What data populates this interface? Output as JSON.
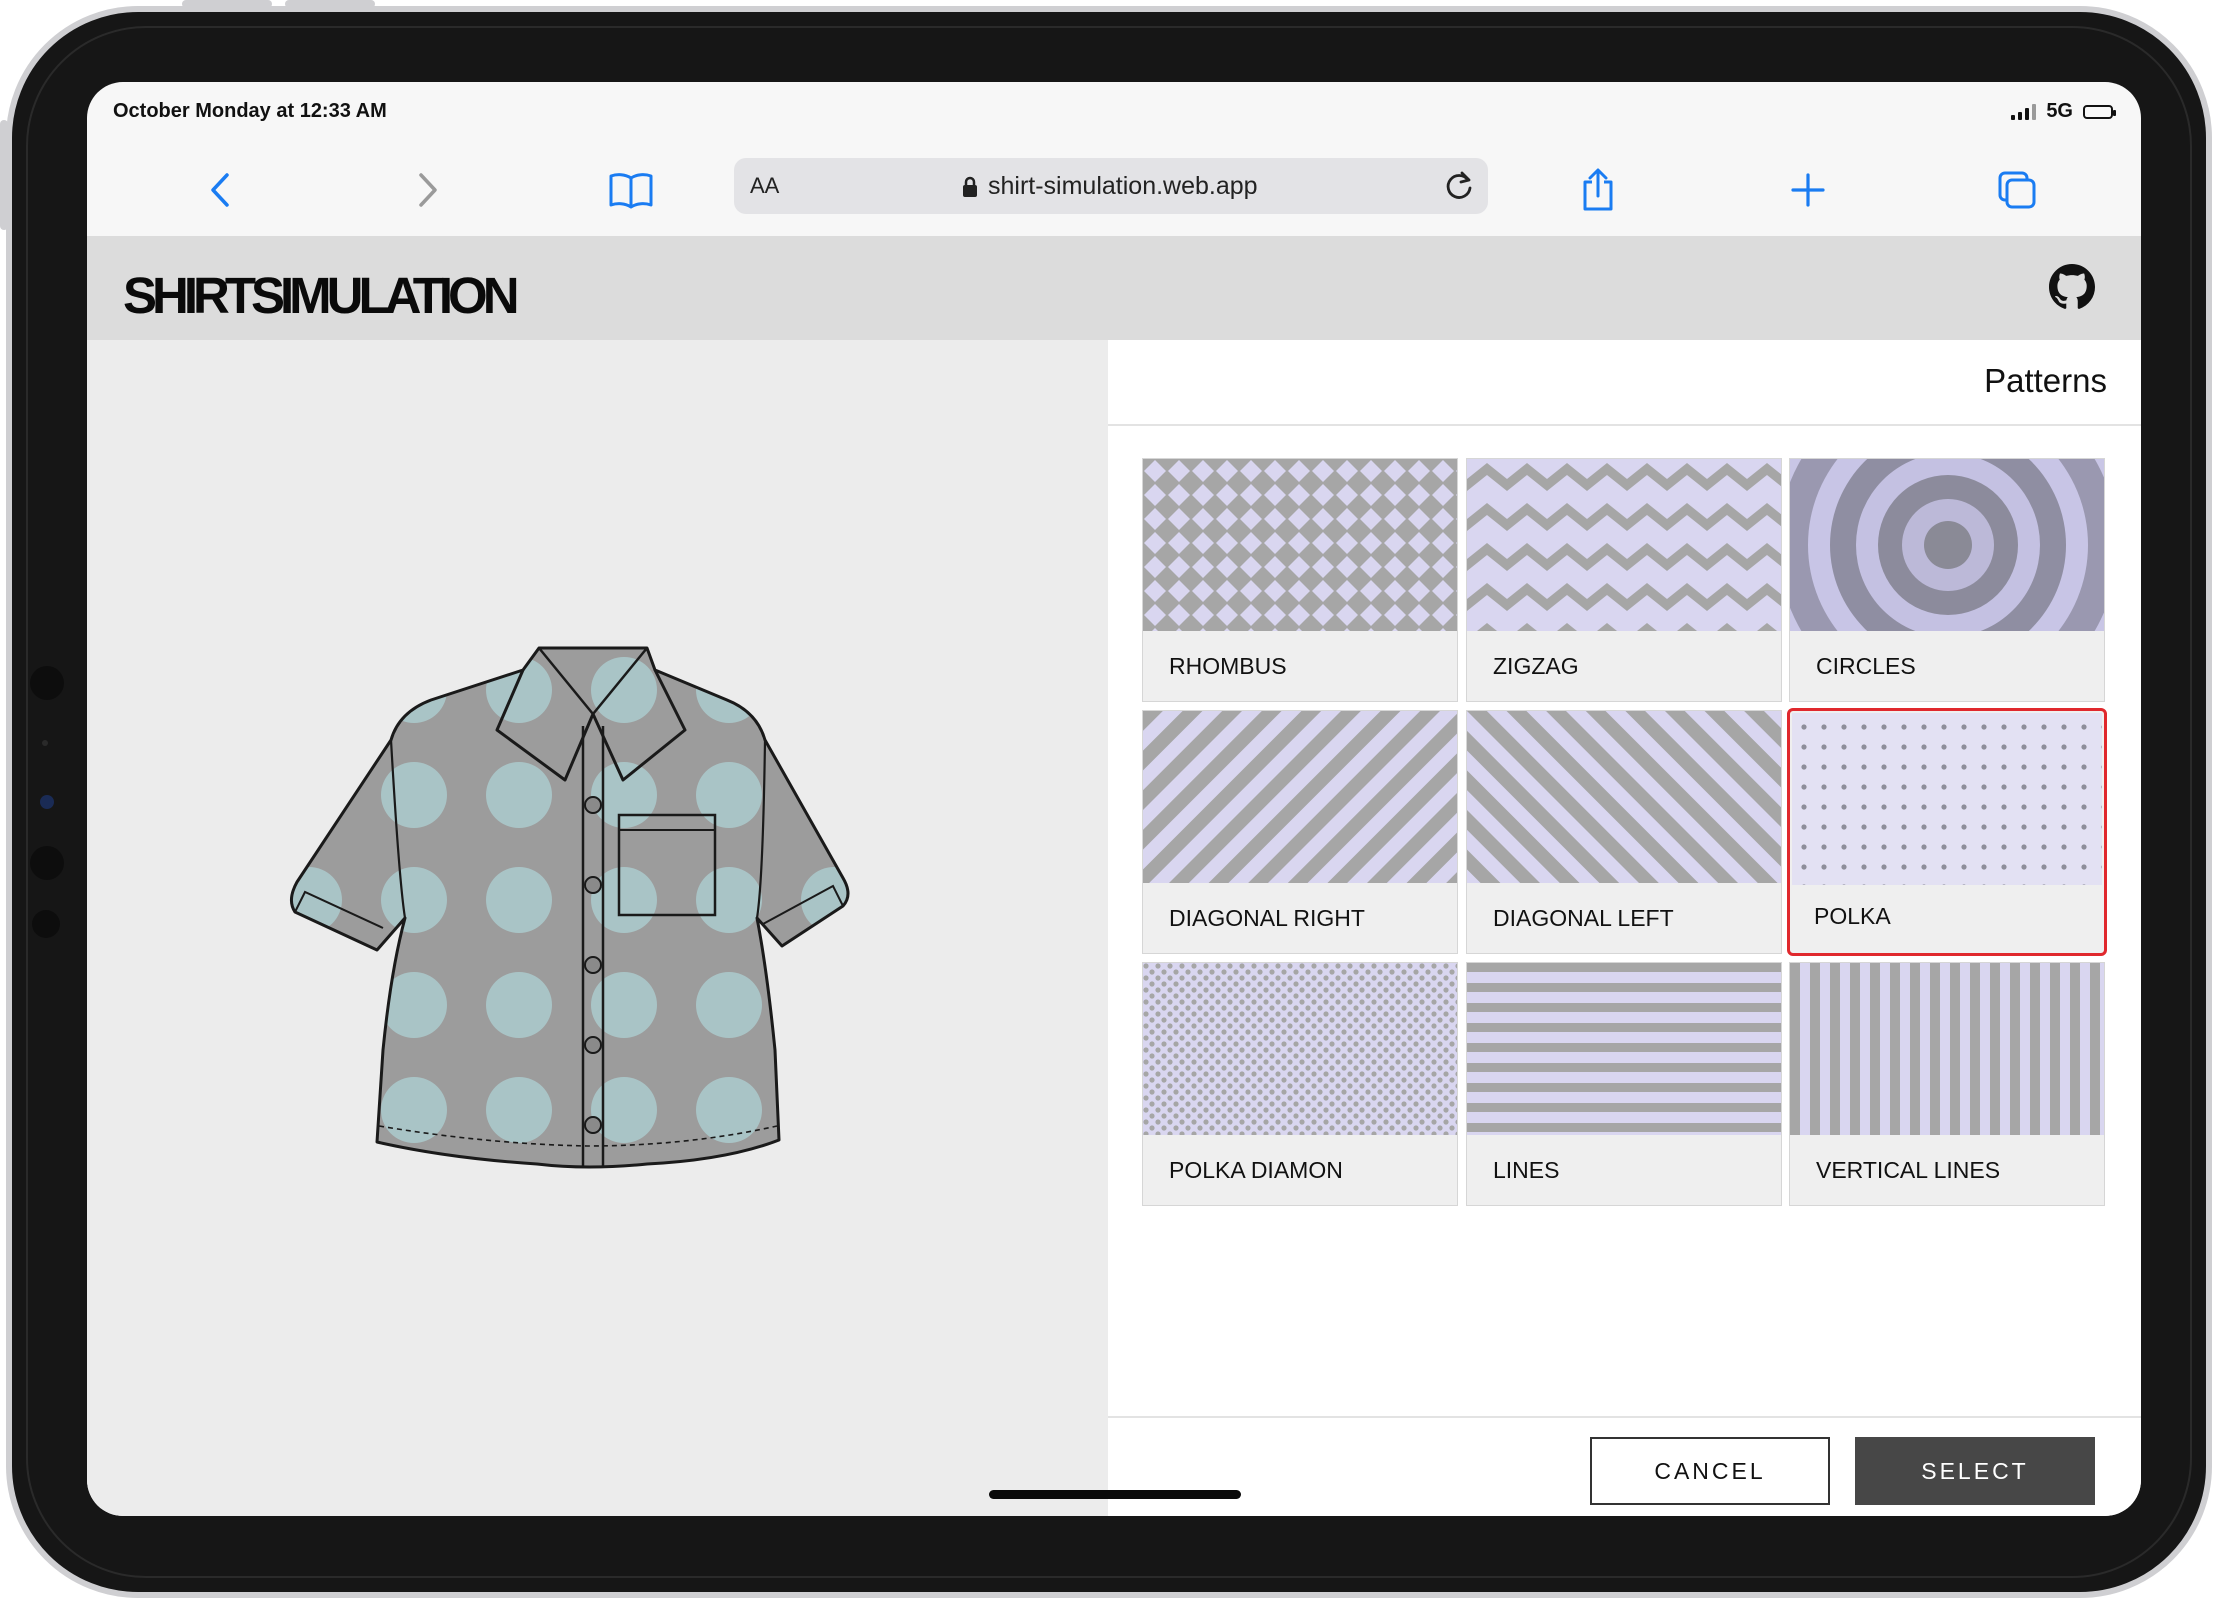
{
  "status": {
    "time": "October Monday at 12:33 AM",
    "network": "5G"
  },
  "browser": {
    "url_text_size": "AA",
    "url": "shirt-simulation.web.app",
    "icons": [
      "back-icon",
      "forward-icon",
      "bookmarks-icon",
      "lock-icon",
      "reload-icon",
      "share-icon",
      "new-tab-icon",
      "tabs-icon"
    ]
  },
  "app": {
    "logo": "SHIRTSIMULATION",
    "github_icon": "github-icon"
  },
  "panel": {
    "title": "Patterns",
    "patterns": [
      {
        "label": "RHOMBUS",
        "selected": false
      },
      {
        "label": "ZIGZAG",
        "selected": false
      },
      {
        "label": "CIRCLES",
        "selected": false
      },
      {
        "label": "DIAGONAL RIGHT",
        "selected": false
      },
      {
        "label": "DIAGONAL LEFT",
        "selected": false
      },
      {
        "label": "POLKA",
        "selected": true
      },
      {
        "label": "POLKA DIAMON",
        "selected": false
      },
      {
        "label": "LINES",
        "selected": false
      },
      {
        "label": "VERTICAL LINES",
        "selected": false
      }
    ],
    "cancel_label": "CANCEL",
    "select_label": "SELECT"
  },
  "colors": {
    "selection": "#e0282d",
    "accent": "#1a7cf2",
    "pattern_gray": "#a8a8a8",
    "pattern_lilac": "#d9d6f0",
    "shirt_dot": "#a9c4c6"
  }
}
